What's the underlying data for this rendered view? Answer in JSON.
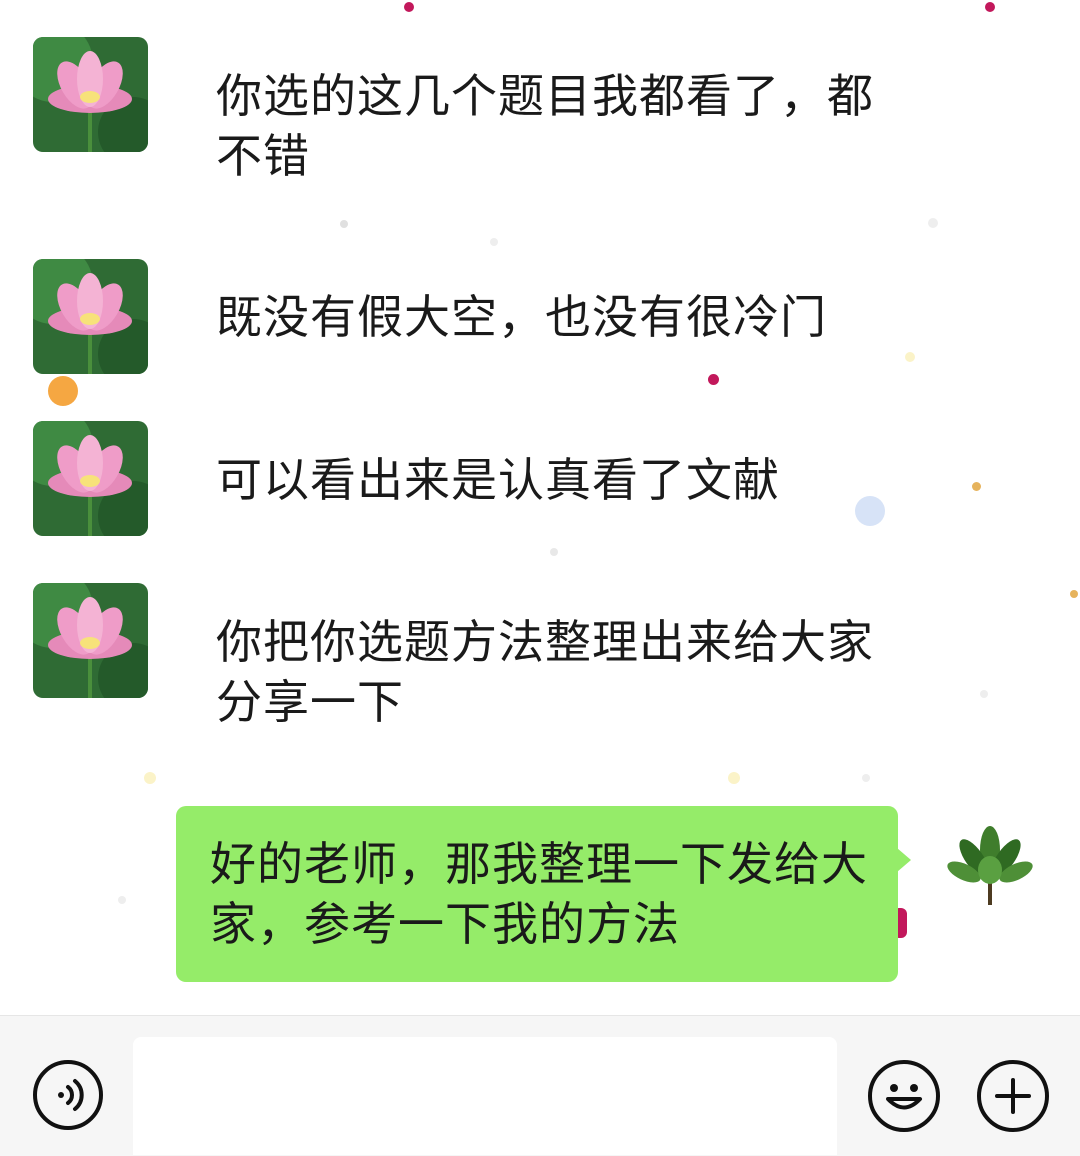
{
  "messages": [
    {
      "sender": "contact",
      "avatar": "lotus-avatar",
      "text": "你选的这几个题目我都看了，都不错"
    },
    {
      "sender": "contact",
      "avatar": "lotus-avatar",
      "text": "既没有假大空，也没有很冷门"
    },
    {
      "sender": "contact",
      "avatar": "lotus-avatar",
      "text": "可以看出来是认真看了文献"
    },
    {
      "sender": "contact",
      "avatar": "lotus-avatar",
      "text": "你把你选题方法整理出来给大家分享一下"
    },
    {
      "sender": "self",
      "avatar": "leaf-avatar",
      "text": "好的老师，那我整理一下发给大家，参考一下我的方法"
    }
  ],
  "input_bar": {
    "value": "",
    "voice_icon": "voice-icon",
    "emoji_icon": "emoji-icon",
    "plus_icon": "plus-icon"
  },
  "colors": {
    "self_bubble": "#95ec69",
    "background": "#ffffff",
    "input_bar": "#f6f6f6"
  }
}
